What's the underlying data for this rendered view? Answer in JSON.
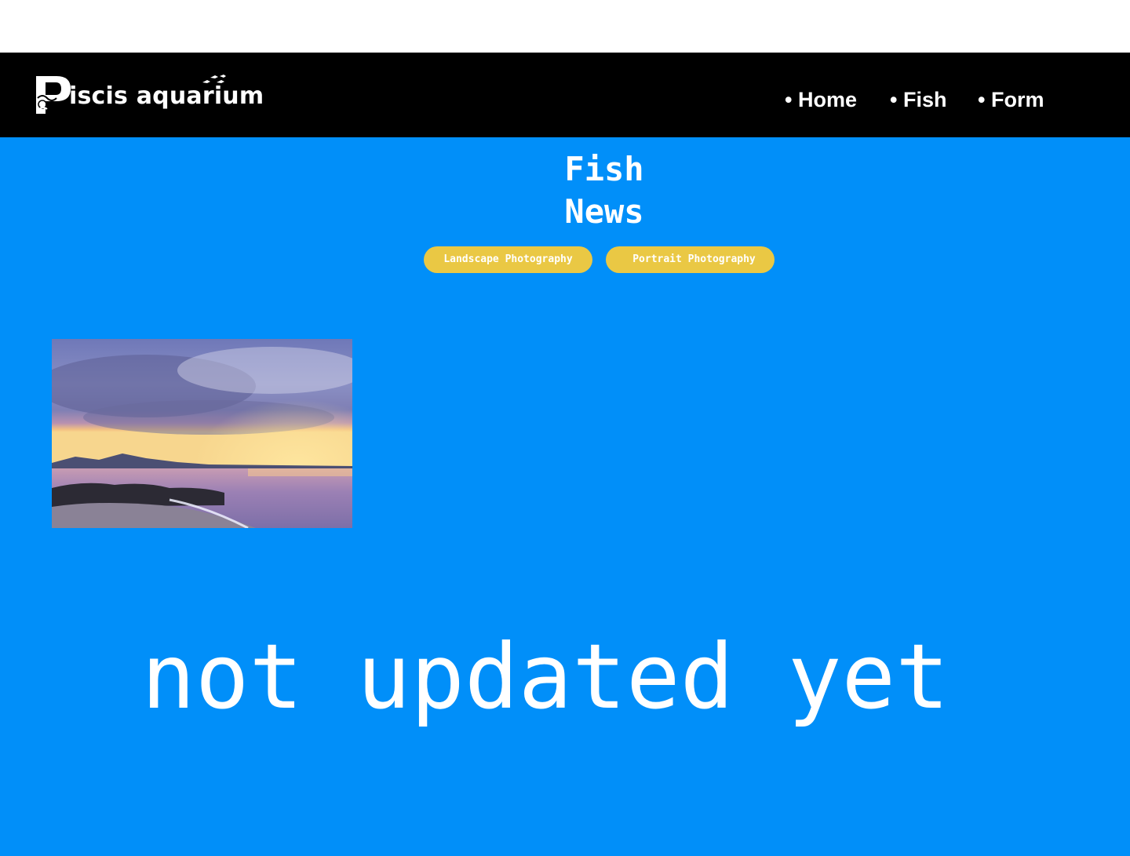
{
  "brand": {
    "name": "iscis aquarium",
    "logo_letter": "P",
    "fish_icon": "fish-school-icon"
  },
  "nav": {
    "items": [
      {
        "label": "• Home"
      },
      {
        "label": "• Fish"
      },
      {
        "label": "• Form"
      }
    ]
  },
  "main": {
    "title_line1": "Fish",
    "title_line2": "News",
    "filters": [
      {
        "label": "Landscape Photography"
      },
      {
        "label": "Portrait Photography"
      }
    ],
    "photo_subject": "seascape-sunset-image",
    "status_text": "not updated yet"
  },
  "colors": {
    "navbar": "#000000",
    "background": "#018ff9",
    "pill": "#eac844",
    "text": "#ffffff"
  }
}
